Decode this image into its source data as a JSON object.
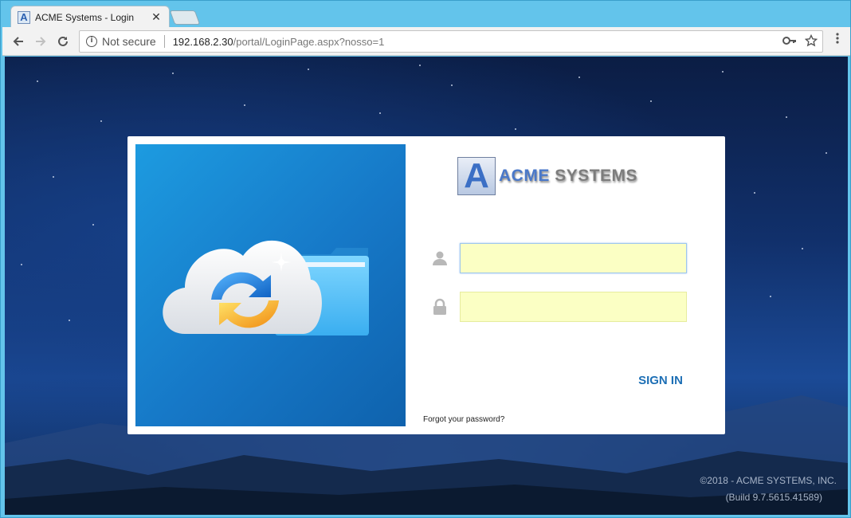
{
  "browser": {
    "tab_title": "ACME Systems - Login",
    "favicon_letter": "A",
    "close_symbol": "✕",
    "not_secure": "Not secure",
    "url_host": "192.168.2.30",
    "url_path": "/portal/LoginPage.aspx?nosso=1",
    "icons": {
      "back": "arrow-left-icon",
      "forward": "arrow-right-icon",
      "reload": "reload-icon",
      "info": "info-icon",
      "key": "key-icon",
      "star": "star-icon",
      "menu": "kebab-menu-icon"
    }
  },
  "login": {
    "logo_letter": "A",
    "logo_word1": "ACME",
    "logo_word2": "SYSTEMS",
    "username_value": "",
    "password_value": "",
    "sign_in_label": "SIGN IN",
    "forgot_label": "Forgot your password?"
  },
  "footer": {
    "copyright": "©2018 - ACME SYSTEMS, INC.",
    "build": "(Build 9.7.5615.41589)"
  },
  "colors": {
    "accent": "#1d6fb5",
    "field_fill": "#fbffc4",
    "frame": "#63c4eb"
  }
}
